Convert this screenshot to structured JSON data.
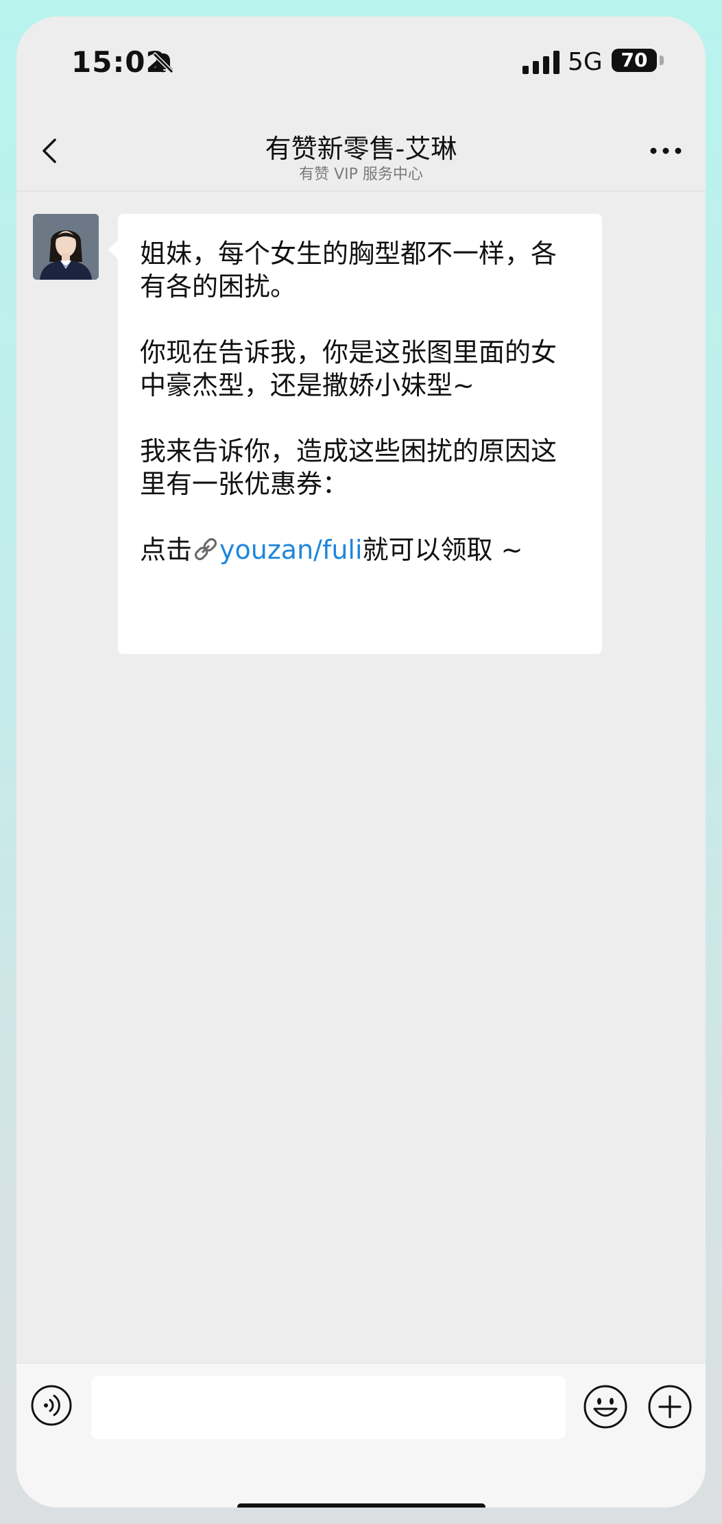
{
  "status_bar": {
    "time": "15:02",
    "network": "5G",
    "battery": "70",
    "icons": [
      "bell-muted-icon",
      "signal-icon",
      "battery-icon"
    ]
  },
  "nav": {
    "title": "有赞新零售-艾琳",
    "subtitle": "有赞 VIP 服务中心",
    "icons": [
      "back-chevron-icon",
      "more-dots-icon"
    ]
  },
  "chat": {
    "messages": [
      {
        "sender": "avatar",
        "paragraphs": [
          "姐妹，每个女生的胸型都不一样，各有各的困扰。",
          "你现在告诉我，你是这张图里面的女中豪杰型，还是撒娇小妹型~",
          "我来告诉你，造成这些困扰的原因这里有一张优惠券："
        ],
        "last_line": {
          "prefix": "点击",
          "link_icon": "link-icon",
          "link_text": "youzan/fuli",
          "suffix": "就可以领取 ~"
        }
      }
    ]
  },
  "input_bar": {
    "value": "",
    "placeholder": "",
    "icons": [
      "voice-icon",
      "emoji-icon",
      "plus-icon"
    ]
  },
  "colors": {
    "link": "#1f86dc",
    "chat_background": "#ededed",
    "bubble": "#ffffff"
  }
}
